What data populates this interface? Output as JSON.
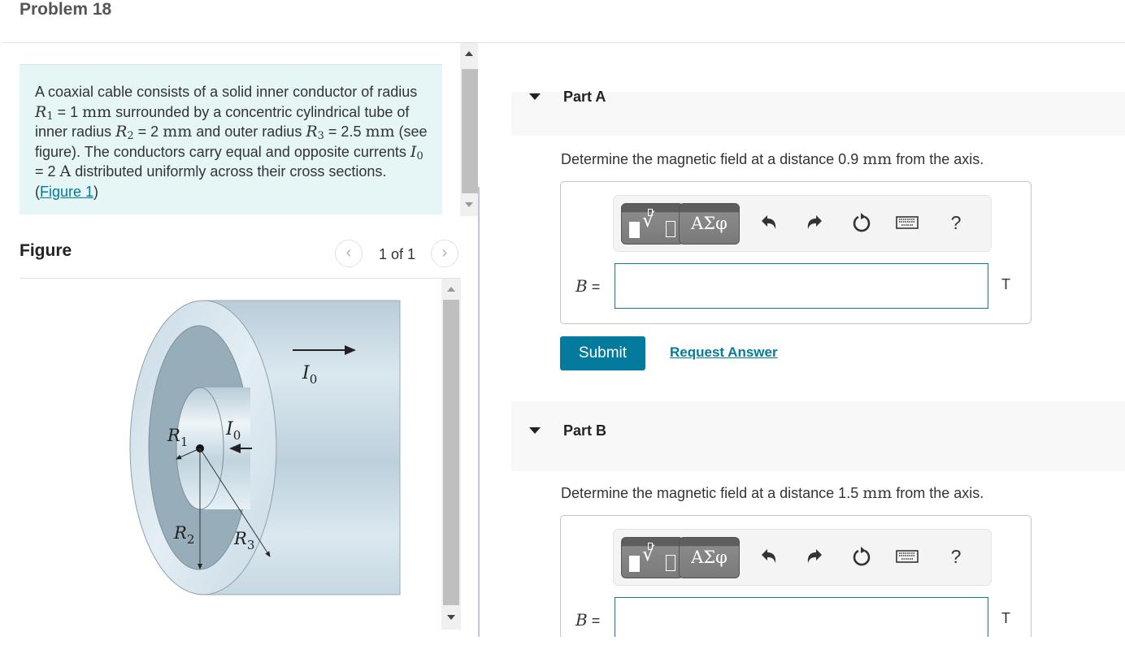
{
  "page": {
    "title": "Problem 18"
  },
  "problem": {
    "text_1": "A coaxial cable consists of a solid inner conductor of radius ",
    "R1_symbol": "R",
    "R1_sub": "1",
    "R1_value": " = 1 ",
    "R1_unit": "mm",
    "text_2": " surrounded by a concentric cylindrical tube of inner radius ",
    "R2_symbol": "R",
    "R2_sub": "2",
    "R2_value": " = 2 ",
    "R2_unit": "mm",
    "text_3": " and outer radius ",
    "R3_symbol": "R",
    "R3_sub": "3",
    "R3_value": " = 2.5 ",
    "R3_unit": "mm",
    "text_4": " (see figure). The conductors carry equal and opposite currents ",
    "I0_symbol": "I",
    "I0_sub": "0",
    "I0_value": " = 2 ",
    "I0_unit": "A",
    "text_5": " distributed uniformly across their cross sections. (",
    "figure_link": "Figure 1",
    "text_6": ")"
  },
  "figure": {
    "label": "Figure",
    "counter": "1 of 1",
    "prev_icon": "chevron-left-icon",
    "next_icon": "chevron-right-icon",
    "prev_glyph": "‹",
    "next_glyph": "›",
    "labels": {
      "I0_top": "I",
      "I0_top_sub": "0",
      "I0_inner": "I",
      "I0_inner_sub": "0",
      "R1": "R",
      "R1_sub": "1",
      "R2": "R",
      "R2_sub": "2",
      "R3": "R",
      "R3_sub": "3"
    },
    "colors": {
      "outer_tube": "#cfdfe8",
      "inner_cavity": "#94aab6",
      "inner_conductor": "#dce9f0"
    }
  },
  "parts": [
    {
      "title": "Part A",
      "question_pre": "Determine the magnetic field at a distance 0.9 ",
      "question_unit": "mm",
      "question_post": " from the axis.",
      "variable": "B",
      "equals": " =",
      "input_value": "",
      "unit": "T",
      "submit_label": "Submit",
      "request_label": "Request Answer"
    },
    {
      "title": "Part B",
      "question_pre": "Determine the magnetic field at a distance 1.5 ",
      "question_unit": "mm",
      "question_post": " from the axis.",
      "variable": "B",
      "equals": " =",
      "input_value": "",
      "unit": "T"
    }
  ],
  "toolbar": {
    "template_icon": "templates-icon",
    "greek_label": "ΑΣφ",
    "undo_icon": "undo-icon",
    "redo_icon": "redo-icon",
    "reset_icon": "reset-icon",
    "keyboard_icon": "keyboard-icon",
    "help_label": "?"
  },
  "colors": {
    "accent": "#047a9c",
    "problem_bg": "#e6f5f6",
    "part_header_bg": "#f8f8f8"
  }
}
